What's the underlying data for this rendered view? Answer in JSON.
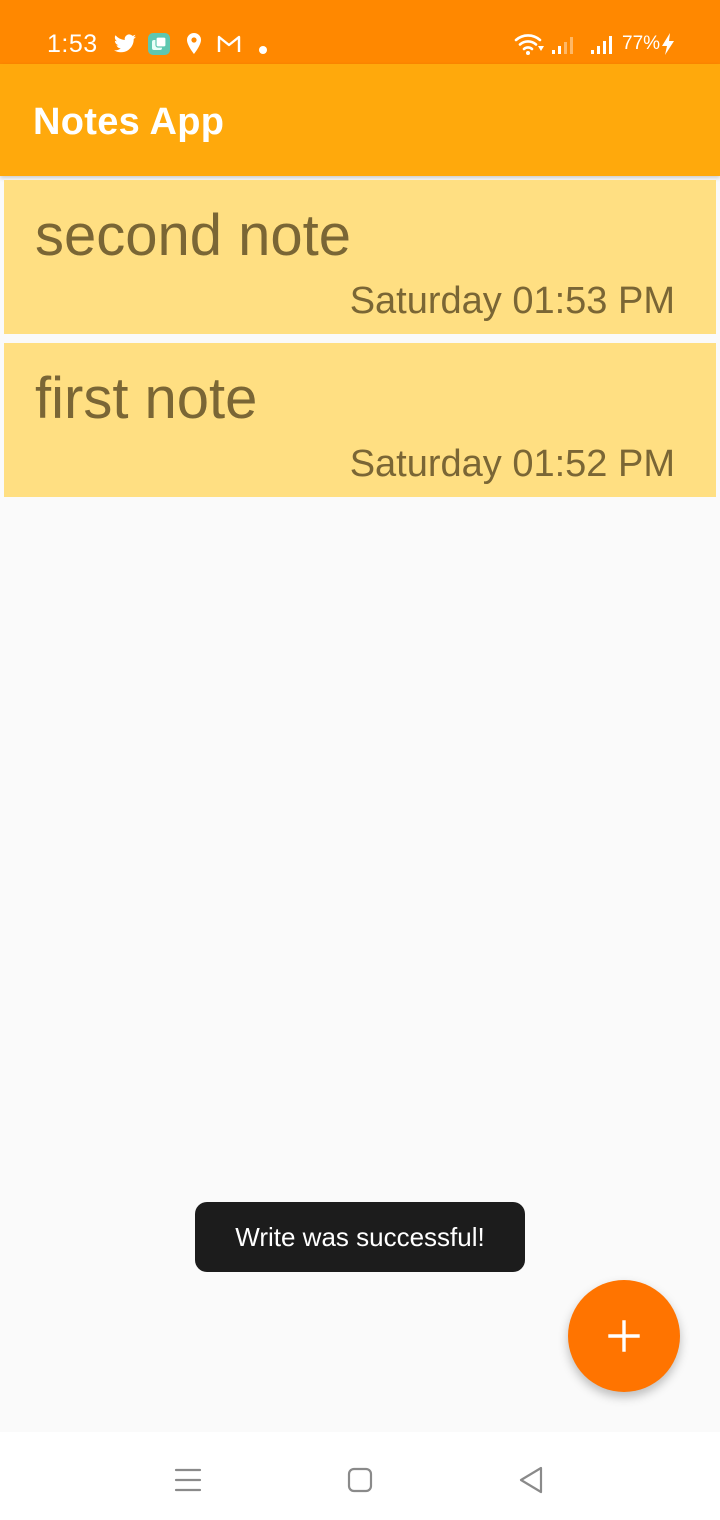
{
  "status_bar": {
    "time": "1:53",
    "battery": "77%",
    "icons": [
      "twitter-icon",
      "chat-app-icon",
      "location-icon",
      "gmail-icon",
      "notification-dot-icon",
      "wifi-icon",
      "signal-icon",
      "signal-icon",
      "charging-icon"
    ]
  },
  "app_bar": {
    "title": "Notes App"
  },
  "notes": [
    {
      "title": "second note",
      "date": "Saturday 01:53 PM"
    },
    {
      "title": "first note",
      "date": "Saturday 01:52 PM"
    }
  ],
  "toast": {
    "message": "Write was successful!"
  },
  "fab": {
    "icon": "plus-icon"
  },
  "nav_bar": {
    "icons": [
      "menu-icon",
      "home-icon",
      "back-icon"
    ]
  },
  "colors": {
    "status_bar": "#ff8800",
    "app_bar": "#ffa90c",
    "note_card": "#ffdf82",
    "note_text": "#7a6635",
    "fab": "#ff7400",
    "toast": "#1c1c1c"
  }
}
